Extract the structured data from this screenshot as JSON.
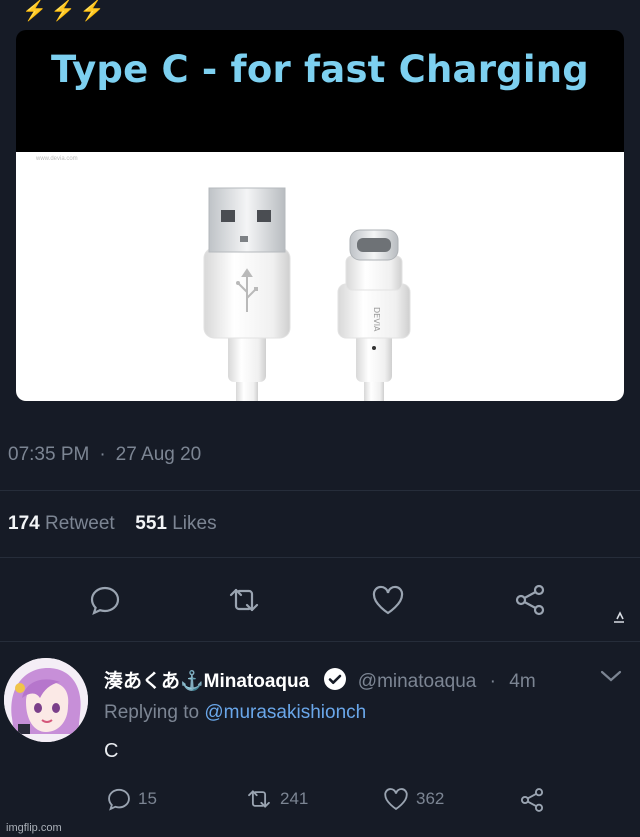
{
  "tweet": {
    "emoji": "⚡⚡⚡",
    "media": {
      "title": "Type C - for fast Charging",
      "watermark_small": "www.devia.com",
      "cable_brand": "DEVIA"
    },
    "time": "07:35 PM",
    "date": "27 Aug 20",
    "retweet_count": "174",
    "retweet_label": "Retweet",
    "likes_count": "551",
    "likes_label": "Likes"
  },
  "actions": {
    "icons": [
      "comment-icon",
      "retweet-icon",
      "heart-icon",
      "share-icon"
    ]
  },
  "reply": {
    "display_name": "湊あくあ⚓Minatoaqua",
    "handle": "@minatoaqua",
    "separator": "·",
    "time_ago": "4m",
    "replying_to_label": "Replying to",
    "replying_to_handle": "@murasakishionch",
    "text": "C",
    "reply_count": "15",
    "retweet_count": "241",
    "like_count": "362"
  },
  "footer": {
    "watermark": "imgflip.com"
  },
  "colors": {
    "background": "#161b26",
    "title_cyan": "#7dd0f0",
    "muted": "#7c8593",
    "link": "#6aa7ea",
    "emoji_yellow": "#f5c71a"
  }
}
